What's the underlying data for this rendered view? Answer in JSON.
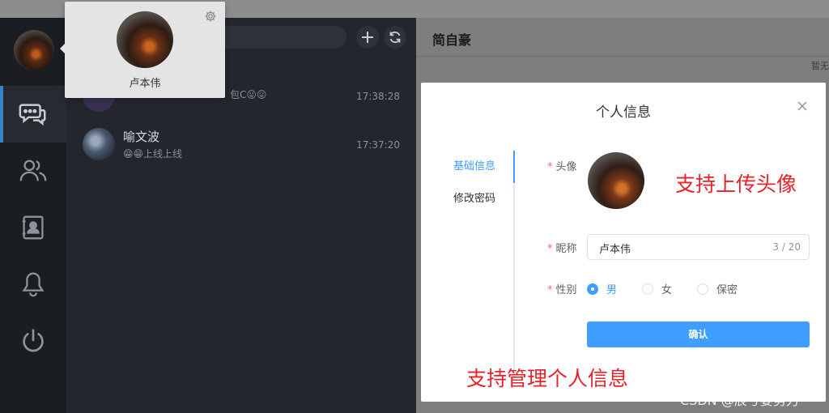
{
  "user": {
    "name": "卢本伟"
  },
  "nav": {
    "items": [
      {
        "name": "messages",
        "icon": "chat-bubbles-icon",
        "active": true
      },
      {
        "name": "friends",
        "icon": "users-icon",
        "active": false
      },
      {
        "name": "contacts",
        "icon": "contact-book-icon",
        "active": false
      },
      {
        "name": "notifications",
        "icon": "bell-icon",
        "active": false
      },
      {
        "name": "logout",
        "icon": "power-icon",
        "active": false
      }
    ]
  },
  "chat_list": {
    "items": [
      {
        "name": "",
        "snippet": "包C😛😛",
        "time": "17:38:28"
      },
      {
        "name": "喻文波",
        "snippet": "😁😁上线上线",
        "time": "17:37:20"
      }
    ]
  },
  "chat_pane": {
    "title": "简自豪",
    "empty_text": "暂无"
  },
  "dialog": {
    "title": "个人信息",
    "tabs": [
      "基础信息",
      "修改密码"
    ],
    "avatar_label": "头像",
    "nickname_label": "昵称",
    "nickname_value": "卢本伟",
    "nickname_count": "3 / 20",
    "gender_label": "性别",
    "gender_options": [
      "男",
      "女",
      "保密"
    ],
    "gender_selected": "男",
    "confirm_label": "确认"
  },
  "annotations": {
    "upload_avatar": "支持上传头像",
    "manage_info": "支持管理个人信息"
  },
  "watermark": "CSDN @辰兮要努力",
  "colors": {
    "primary": "#409eff",
    "nav_bg": "#1a1d21",
    "list_bg": "#23272d",
    "annotation": "#e8212a"
  }
}
